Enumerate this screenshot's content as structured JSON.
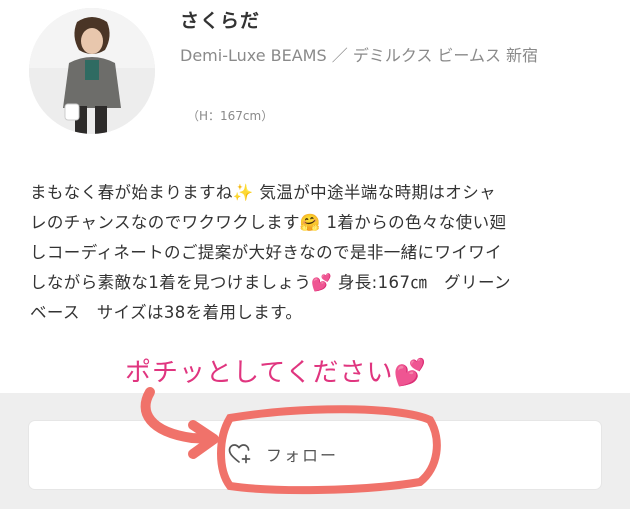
{
  "profile": {
    "name": "さくらだ",
    "store": "Demi-Luxe BEAMS ／ デミルクス ビームス 新宿",
    "height": "（H：167cm）"
  },
  "bio": {
    "line1": "まもなく春が始まりますね✨ 気温が中途半端な時期はオシャ",
    "line2": "レのチャンスなのでワクワクします🤗 1着からの色々な使い廻",
    "line3": "しコーディネートのご提案が大好きなので是非一緒にワイワイ",
    "line4": "しながら素敵な1着を見つけましょう💕 身長:167㎝　グリーン",
    "line5": "ベース　サイズは38を着用します。"
  },
  "follow_button": {
    "label": "フォロー",
    "icon": "heart-plus-icon"
  },
  "annotation": {
    "text": "ポチッとしてください💕",
    "color": "#e0357f",
    "marker_color": "#f0726a"
  }
}
